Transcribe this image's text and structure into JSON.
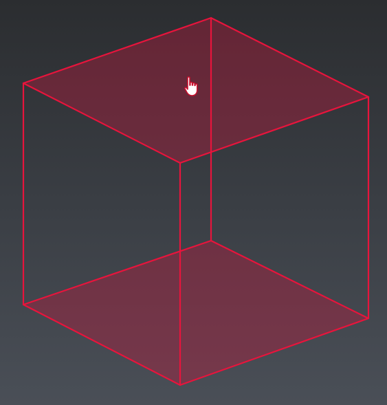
{
  "viewport": {
    "background_top": "#2b2d30",
    "background_bottom": "#4a4f57"
  },
  "cube": {
    "edge_color": "#e8143c",
    "face_fill": "#c0173c",
    "face_opacity": 0.38,
    "selected_faces": [
      "top",
      "bottom"
    ]
  },
  "cursor": {
    "icon": "pointing-hand-cursor-icon",
    "fill": "#ffffff",
    "outline": "#c8102e"
  }
}
